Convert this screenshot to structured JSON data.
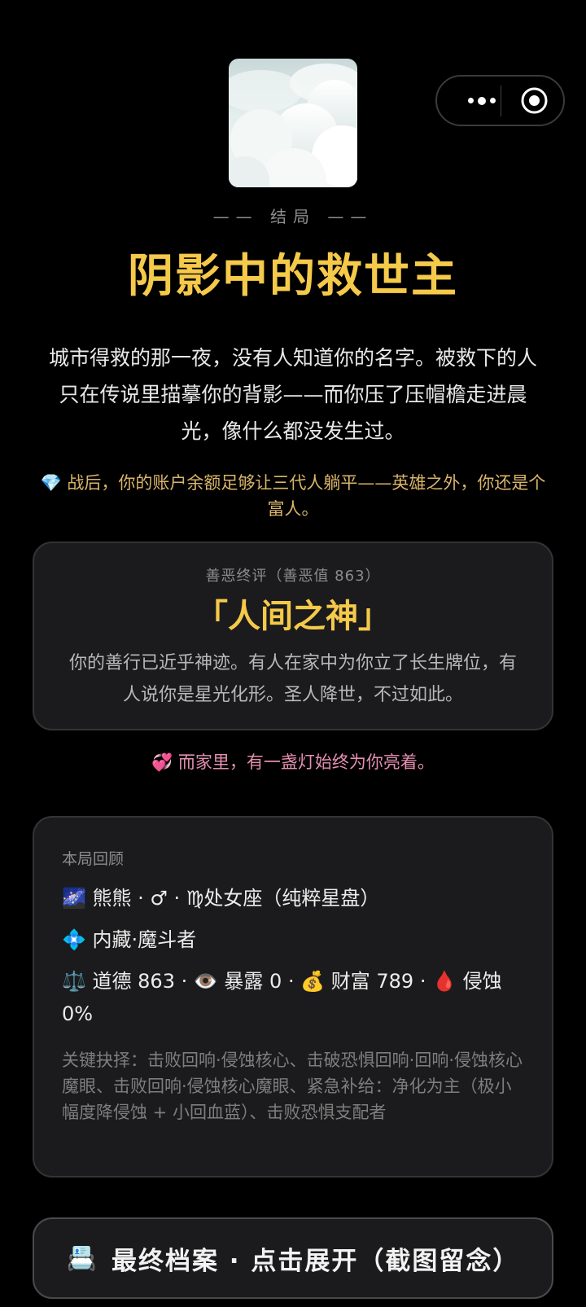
{
  "capsule": {
    "more_icon": "more-dots-icon",
    "close_icon": "target-circle-icon"
  },
  "cover": {
    "image": "cloud-sky-image"
  },
  "ending": {
    "tag": "—— 结局 ——",
    "title": "阴影中的救世主",
    "description": "城市得救的那一夜，没有人知道你的名字。被救下的人只在传说里描摹你的背影——而你压了压帽檐走进晨光，像什么都没发生过。",
    "wealth_emoji": "💎",
    "wealth_text": "战后，你的账户余额足够让三代人躺平——英雄之外，你还是个富人。"
  },
  "verdict": {
    "label": "善恶终评（善恶值 863）",
    "title": "「人间之神」",
    "description": "你的善行已近乎神迹。有人在家中为你立了长生牌位，有人说你是星光化形。圣人降世，不过如此。"
  },
  "family": {
    "emoji": "💞",
    "text": "而家里，有一盏灯始终为你亮着。"
  },
  "review": {
    "heading": "本局回顾",
    "identity_emoji": "🌌",
    "identity_text": "熊熊 · ♂ · ♍处女座（纯粹星盘）",
    "class_emoji": "💠",
    "class_text": "内藏·魔斗者",
    "stats": {
      "morality_emoji": "⚖️",
      "morality": "道德 863",
      "exposure_emoji": "👁️",
      "exposure": "暴露 0",
      "wealth_emoji": "💰",
      "wealth": "财富 789",
      "erosion_emoji": "🩸",
      "erosion": "侵蚀 0%"
    },
    "key_choices": "关键抉择：击败回响·侵蚀核心、击破恐惧回响·回响·侵蚀核心魔眼、击败回响·侵蚀核心魔眼、紧急补给：净化为主（极小幅度降侵蚀 + 小回血蓝）、击败恐惧支配者"
  },
  "archive_button": {
    "emoji": "📇",
    "label": "最终档案 · 点击展开（截图留念）"
  },
  "colors": {
    "background": "#000000",
    "gold": "#f5c94a",
    "card": "#1b1b1d",
    "pink": "#e58fb0",
    "wealth_gold": "#d9b56a"
  }
}
